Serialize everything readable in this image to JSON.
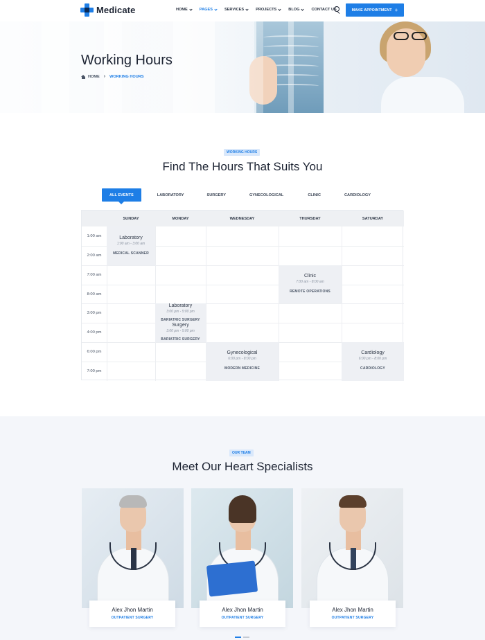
{
  "brand": {
    "name": "Medicate",
    "accent": "#1e7ee6"
  },
  "nav": {
    "items": [
      {
        "label": "HOME",
        "dropdown": true,
        "active": false
      },
      {
        "label": "PAGES",
        "dropdown": true,
        "active": true
      },
      {
        "label": "SERVICES",
        "dropdown": true,
        "active": false
      },
      {
        "label": "PROJECTS",
        "dropdown": true,
        "active": false
      },
      {
        "label": "BLOG",
        "dropdown": true,
        "active": false
      },
      {
        "label": "CONTACT US",
        "dropdown": false,
        "active": false
      }
    ],
    "search_icon": "search-icon",
    "cta_label": "MAKE APPOINTMENT",
    "cta_icon": "+"
  },
  "hero": {
    "title": "Working Hours",
    "breadcrumb": {
      "home": "HOME",
      "separator": "›",
      "current": "WORKING HOURS"
    }
  },
  "schedule": {
    "pill": "WORKING HOURS",
    "title": "Find The Hours That Suits You",
    "tabs": [
      "ALL EVENTS",
      "LABORATORY",
      "SURGERY",
      "GYNECOLOGICAL",
      "CLINIC",
      "CARDIOLOGY"
    ],
    "active_tab": "ALL EVENTS",
    "days": [
      "SUNDAY",
      "MONDAY",
      "WEDNESDAY",
      "THURSDAY",
      "SATURDAY"
    ],
    "times": [
      "1:00 am",
      "2:00 am",
      "7:00 am",
      "8:00 am",
      "3:00 pm",
      "4:00 pm",
      "6:00 pm",
      "7:00 pm"
    ],
    "events": [
      {
        "title": "Laboratory",
        "time": "1:00 am - 3:00 am",
        "sub": "MEDICAL SCANNER"
      },
      {
        "title": "Clinic",
        "time": "7:00 am - 8:00 am",
        "sub": "REMOTE OPERATIONS"
      },
      {
        "title": "Laboratory",
        "time": "3:00 pm - 5:00 pm",
        "sub": "BARIATRIC SURGERY"
      },
      {
        "title": "Surgery",
        "time": "3:00 pm - 5:00 pm",
        "sub": "BARIATRIC SURGERY"
      },
      {
        "title": "Gynecological",
        "time": "6:00 pm - 8:00 pm",
        "sub": "MODERN MEDICINE"
      },
      {
        "title": "Cardiology",
        "time": "6:00 pm - 8:00 pm",
        "sub": "CARDIOLOGY"
      }
    ]
  },
  "team": {
    "pill": "OUR TEAM",
    "title": "Meet Our Heart Specialists",
    "members": [
      {
        "name": "Alex Jhon Martin",
        "role": "OUTPATIENT SURGERY"
      },
      {
        "name": "Alex Jhon Martin",
        "role": "OUTPATIENT SURGERY"
      },
      {
        "name": "Alex Jhon Martin",
        "role": "OUTPATIENT SURGERY"
      }
    ],
    "carousel_pages": 2,
    "carousel_active": 1
  }
}
